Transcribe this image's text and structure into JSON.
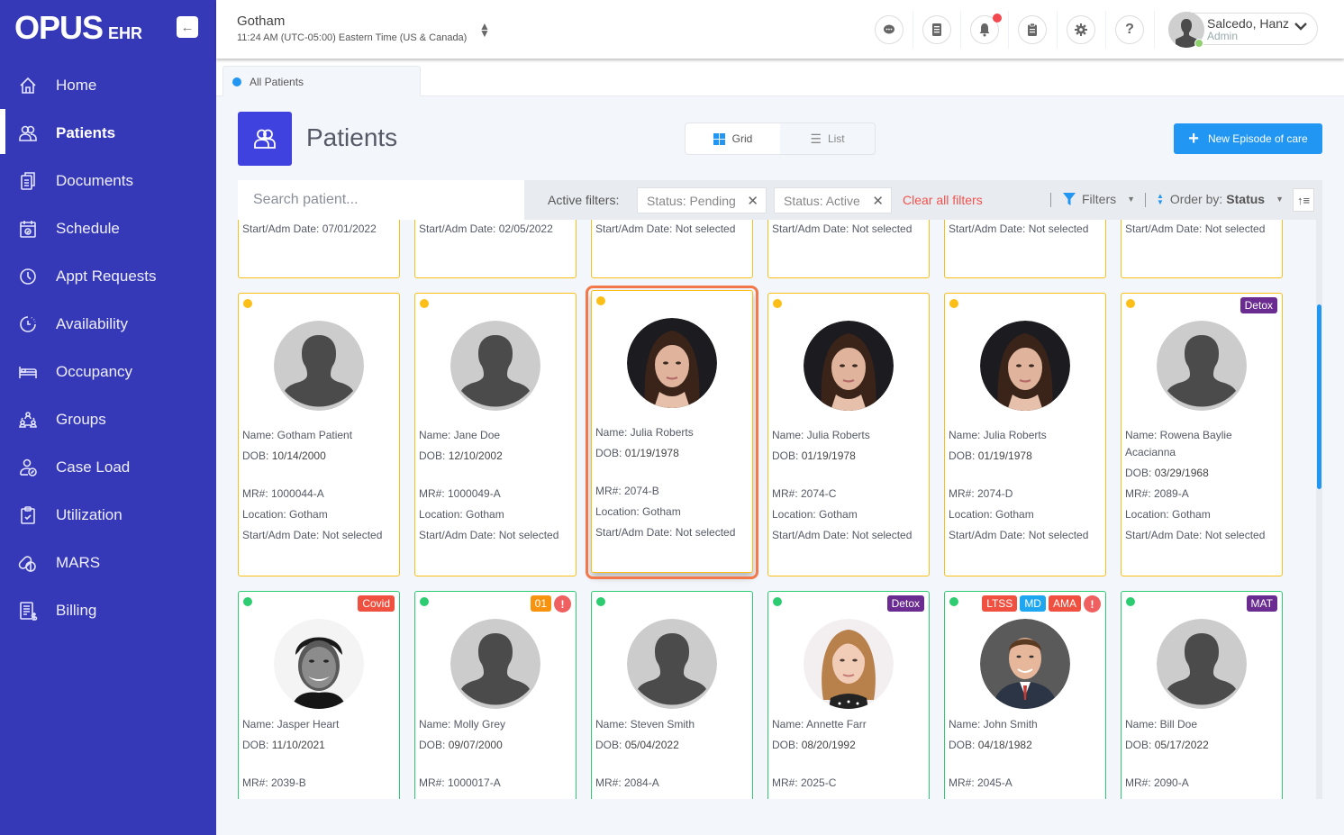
{
  "app": {
    "logo_text": "OPUS",
    "logo_suffix": "EHR",
    "collapse_icon": "arrow-left-icon"
  },
  "sidebar": {
    "items": [
      {
        "label": "Home",
        "icon": "home-icon",
        "active": false
      },
      {
        "label": "Patients",
        "icon": "patients-icon",
        "active": true
      },
      {
        "label": "Documents",
        "icon": "documents-icon",
        "active": false
      },
      {
        "label": "Schedule",
        "icon": "calendar-icon",
        "active": false
      },
      {
        "label": "Appt Requests",
        "icon": "clock-icon",
        "active": false
      },
      {
        "label": "Availability",
        "icon": "availability-icon",
        "active": false
      },
      {
        "label": "Occupancy",
        "icon": "bed-icon",
        "active": false
      },
      {
        "label": "Groups",
        "icon": "groups-icon",
        "active": false
      },
      {
        "label": "Case Load",
        "icon": "case-load-icon",
        "active": false
      },
      {
        "label": "Utilization",
        "icon": "clipboard-check-icon",
        "active": false
      },
      {
        "label": "MARS",
        "icon": "pills-icon",
        "active": false
      },
      {
        "label": "Billing",
        "icon": "billing-icon",
        "active": false
      }
    ]
  },
  "topbar": {
    "location": "Gotham",
    "time": "11:24 AM (UTC-05:00) Eastern Time (US & Canada)",
    "icons": [
      "chat-icon",
      "notes-icon",
      "bell-icon",
      "clipboard-icon",
      "gear-icon",
      "help-icon"
    ],
    "notification_dot": true,
    "user": {
      "name": "Salcedo, Hanz",
      "role": "Admin",
      "online": true
    }
  },
  "tabs": [
    {
      "label": "All Patients",
      "active": true
    }
  ],
  "page": {
    "title": "Patients",
    "view_toggle": {
      "grid": "Grid",
      "list": "List",
      "selected": "Grid"
    },
    "new_button": "New Episode of care"
  },
  "filterbar": {
    "search_placeholder": "Search patient...",
    "active_filters_label": "Active filters:",
    "chips": [
      "Status: Pending",
      "Status: Active"
    ],
    "clear_all": "Clear all filters",
    "filters_label": "Filters",
    "order_by_label": "Order by:",
    "order_by_value": "Status"
  },
  "colors": {
    "sidebar": "#3639b7",
    "accent": "#2196f3",
    "pending": "#fbbf18",
    "active": "#2ecc71",
    "selected": "#f3784a",
    "danger": "#f0534f"
  },
  "grid": {
    "row0": [
      {
        "start": "Start/Adm Date: 07/01/2022"
      },
      {
        "start": "Start/Adm Date: 02/05/2022"
      },
      {
        "start": "Start/Adm Date: Not selected"
      },
      {
        "start": "Start/Adm Date: Not selected"
      },
      {
        "start": "Start/Adm Date: Not selected"
      },
      {
        "start": "Start/Adm Date: Not selected"
      }
    ],
    "row1": [
      {
        "status": "pending",
        "photo": "placeholder",
        "badges": [],
        "name": "Name: Gotham Patient",
        "dob_label": "DOB:",
        "dob": "10/14/2000",
        "mr": "MR#: 1000044-A",
        "location": "Location: Gotham",
        "start": "Start/Adm Date: Not selected"
      },
      {
        "status": "pending",
        "photo": "placeholder",
        "badges": [],
        "name": "Name: Jane Doe",
        "dob_label": "DOB:",
        "dob": "12/10/2002",
        "mr": "MR#: 1000049-A",
        "location": "Location: Gotham",
        "start": "Start/Adm Date: Not selected"
      },
      {
        "status": "pending",
        "photo": "woman-dark-hair",
        "badges": [],
        "selected": true,
        "name": "Name: Julia Roberts",
        "dob_label": "DOB:",
        "dob": "01/19/1978",
        "mr": "MR#: 2074-B",
        "location": "Location: Gotham",
        "start": "Start/Adm Date: Not selected"
      },
      {
        "status": "pending",
        "photo": "woman-dark-hair",
        "badges": [],
        "name": "Name: Julia Roberts",
        "dob_label": "DOB:",
        "dob": "01/19/1978",
        "mr": "MR#: 2074-C",
        "location": "Location: Gotham",
        "start": "Start/Adm Date: Not selected"
      },
      {
        "status": "pending",
        "photo": "woman-dark-hair",
        "badges": [],
        "name": "Name: Julia Roberts",
        "dob_label": "DOB:",
        "dob": "01/19/1978",
        "mr": "MR#: 2074-D",
        "location": "Location: Gotham",
        "start": "Start/Adm Date: Not selected"
      },
      {
        "status": "pending",
        "photo": "placeholder",
        "badges": [
          {
            "text": "Detox",
            "color": "#6a2c91"
          }
        ],
        "name": "Name: Rowena Baylie Acacianna",
        "dob_label": "DOB:",
        "dob": "03/29/1968",
        "mr": "MR#: 2089-A",
        "location": "Location: Gotham",
        "start": "Start/Adm Date: Not selected"
      }
    ],
    "row2": [
      {
        "status": "active",
        "photo": "man-bw",
        "badges": [
          {
            "text": "Covid",
            "color": "#f0503f"
          }
        ],
        "alert": false,
        "name": "Name: Jasper Heart",
        "dob_label": "DOB:",
        "dob": "11/10/2021",
        "mr": "MR#: 2039-B"
      },
      {
        "status": "active",
        "photo": "placeholder",
        "badges": [
          {
            "text": "01",
            "color": "#f7930f"
          }
        ],
        "alert": true,
        "name": "Name: Molly Grey",
        "dob_label": "DOB:",
        "dob": "09/07/2000",
        "mr": "MR#: 1000017-A"
      },
      {
        "status": "active",
        "photo": "placeholder",
        "badges": [],
        "alert": false,
        "name": "Name: Steven Smith",
        "dob_label": "DOB:",
        "dob": "05/04/2022",
        "mr": "MR#: 2084-A"
      },
      {
        "status": "active",
        "photo": "woman-blonde",
        "badges": [
          {
            "text": "Detox",
            "color": "#6a2c91"
          }
        ],
        "alert": false,
        "name": "Name: Annette Farr",
        "dob_label": "DOB:",
        "dob": "08/20/1992",
        "mr": "MR#: 2025-C"
      },
      {
        "status": "active",
        "photo": "man-suit",
        "badges": [
          {
            "text": "LTSS",
            "color": "#f0503f"
          },
          {
            "text": "MD",
            "color": "#1ea7f0"
          },
          {
            "text": "AMA",
            "color": "#f0503f"
          }
        ],
        "alert": true,
        "name": "Name: John Smith",
        "dob_label": "DOB:",
        "dob": "04/18/1982",
        "mr": "MR#: 2045-A"
      },
      {
        "status": "active",
        "photo": "placeholder",
        "badges": [
          {
            "text": "MAT",
            "color": "#6a2c91"
          }
        ],
        "alert": false,
        "name": "Name: Bill Doe",
        "dob_label": "DOB:",
        "dob": "05/17/2022",
        "mr": "MR#: 2090-A"
      }
    ]
  }
}
